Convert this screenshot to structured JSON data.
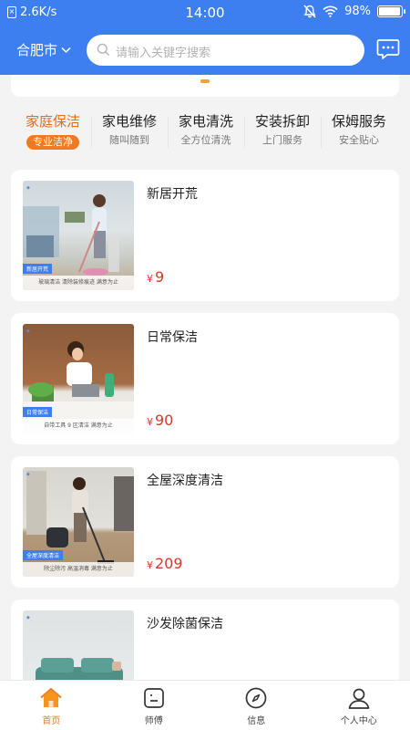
{
  "status_bar": {
    "network_speed": "2.6K/s",
    "time": "14:00",
    "battery": "98%",
    "battery_level": 0.98
  },
  "header": {
    "city": "合肥市",
    "search_placeholder": "请输入关键字搜索"
  },
  "banner": {
    "indicator_color": "#f6a13a"
  },
  "tabs": [
    {
      "title": "家庭保洁",
      "subtitle": "专业洁净",
      "active": true
    },
    {
      "title": "家电维修",
      "subtitle": "随叫随到",
      "active": false
    },
    {
      "title": "家电清洗",
      "subtitle": "全方位清洗",
      "active": false
    },
    {
      "title": "安装拆卸",
      "subtitle": "上门服务",
      "active": false
    },
    {
      "title": "保姆服务",
      "subtitle": "安全贴心",
      "active": false
    }
  ],
  "services": [
    {
      "name": "新居开荒",
      "currency": "¥",
      "price": "9",
      "thumb_tag": "新居开荒",
      "thumb_caption": "玻璃清洁  清除装修痕迹  满意为止"
    },
    {
      "name": "日常保洁",
      "currency": "¥",
      "price": "90",
      "thumb_tag": "日常保洁",
      "thumb_caption": "自带工具  9 区清洁  满意为止"
    },
    {
      "name": "全屋深度清洁",
      "currency": "¥",
      "price": "209",
      "thumb_tag": "全屋深度清洁",
      "thumb_caption": "除尘除污  高温消毒  满意为止"
    },
    {
      "name": "沙发除菌保洁",
      "currency": "",
      "price": "",
      "thumb_tag": "",
      "thumb_caption": ""
    }
  ],
  "bottom_nav": [
    {
      "label": "首页",
      "icon": "home-icon",
      "active": true
    },
    {
      "label": "师傅",
      "icon": "worker-icon",
      "active": false
    },
    {
      "label": "信息",
      "icon": "compass-icon",
      "active": false
    },
    {
      "label": "个人中心",
      "icon": "person-icon",
      "active": false
    }
  ],
  "colors": {
    "brand_blue": "#3d7ff0",
    "accent_orange": "#f07a21",
    "price_red": "#d63a2a"
  }
}
